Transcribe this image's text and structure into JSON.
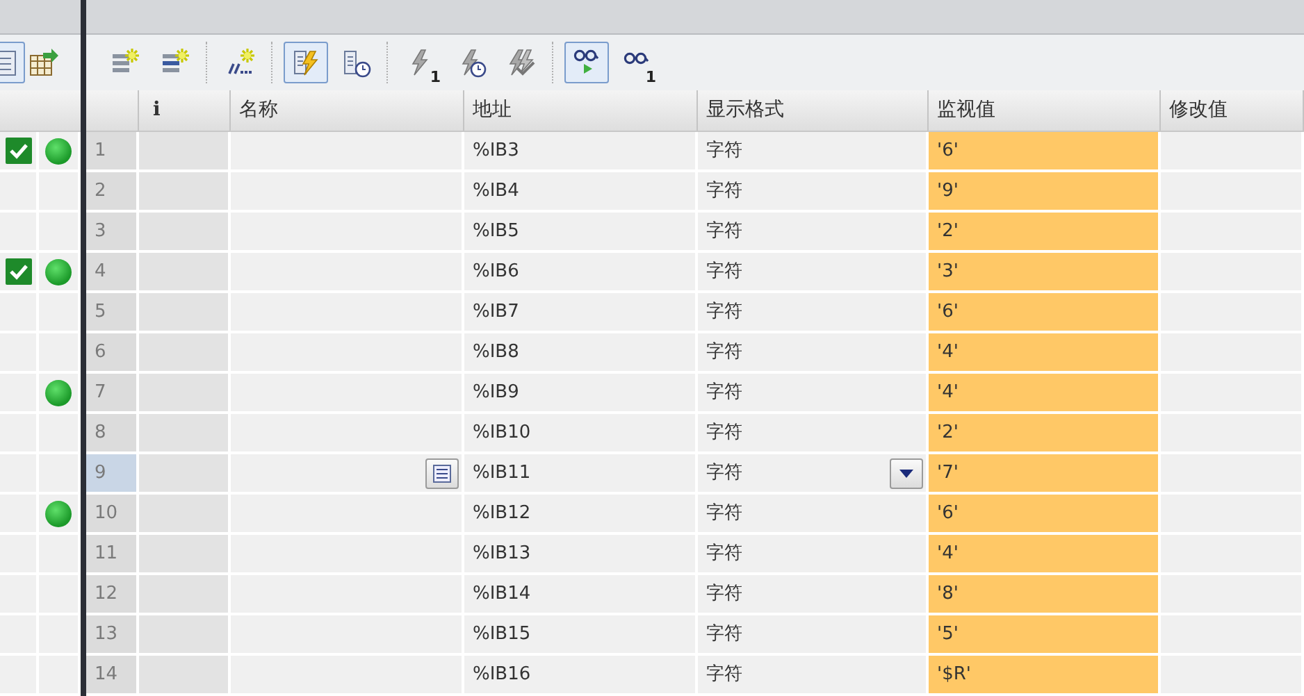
{
  "side_toolbar": [
    {
      "selected": true
    },
    {
      "selected": false
    }
  ],
  "toolbar_groups": [
    {
      "buttons": [
        {
          "selected": false
        },
        {
          "selected": false
        }
      ]
    },
    {
      "buttons": [
        {
          "selected": false
        }
      ]
    },
    {
      "buttons": [
        {
          "selected": true
        },
        {
          "selected": false
        }
      ]
    },
    {
      "buttons": [
        {
          "selected": false,
          "badge": "1"
        },
        {
          "selected": false
        },
        {
          "selected": false
        }
      ]
    },
    {
      "buttons": [
        {
          "selected": true
        },
        {
          "selected": false,
          "badge": "1"
        }
      ]
    }
  ],
  "columns": [
    "i",
    "名称",
    "地址",
    "显示格式",
    "监视值",
    "修改值"
  ],
  "rows": [
    {
      "number": "1",
      "address": "%IB3",
      "format": "字符",
      "value": "'6'",
      "checked": true,
      "status": true,
      "selected": false
    },
    {
      "number": "2",
      "address": "%IB4",
      "format": "字符",
      "value": "'9'",
      "checked": false,
      "status": false,
      "selected": false
    },
    {
      "number": "3",
      "address": "%IB5",
      "format": "字符",
      "value": "'2'",
      "checked": false,
      "status": false,
      "selected": false
    },
    {
      "number": "4",
      "address": "%IB6",
      "format": "字符",
      "value": "'3'",
      "checked": true,
      "status": true,
      "selected": false
    },
    {
      "number": "5",
      "address": "%IB7",
      "format": "字符",
      "value": "'6'",
      "checked": false,
      "status": false,
      "selected": false
    },
    {
      "number": "6",
      "address": "%IB8",
      "format": "字符",
      "value": "'4'",
      "checked": false,
      "status": false,
      "selected": false
    },
    {
      "number": "7",
      "address": "%IB9",
      "format": "字符",
      "value": "'4'",
      "checked": false,
      "status": true,
      "selected": false
    },
    {
      "number": "8",
      "address": "%IB10",
      "format": "字符",
      "value": "'2'",
      "checked": false,
      "status": false,
      "selected": false
    },
    {
      "number": "9",
      "address": "%IB11",
      "format": "字符",
      "value": "'7'",
      "checked": false,
      "status": false,
      "selected": true
    },
    {
      "number": "10",
      "address": "%IB12",
      "format": "字符",
      "value": "'6'",
      "checked": false,
      "status": true,
      "selected": false
    },
    {
      "number": "11",
      "address": "%IB13",
      "format": "字符",
      "value": "'4'",
      "checked": false,
      "status": false,
      "selected": false
    },
    {
      "number": "12",
      "address": "%IB14",
      "format": "字符",
      "value": "'8'",
      "checked": false,
      "status": false,
      "selected": false
    },
    {
      "number": "13",
      "address": "%IB15",
      "format": "字符",
      "value": "'5'",
      "checked": false,
      "status": false,
      "selected": false
    },
    {
      "number": "14",
      "address": "%IB16",
      "format": "字符",
      "value": "'$R'",
      "checked": false,
      "status": false,
      "selected": false
    }
  ]
}
